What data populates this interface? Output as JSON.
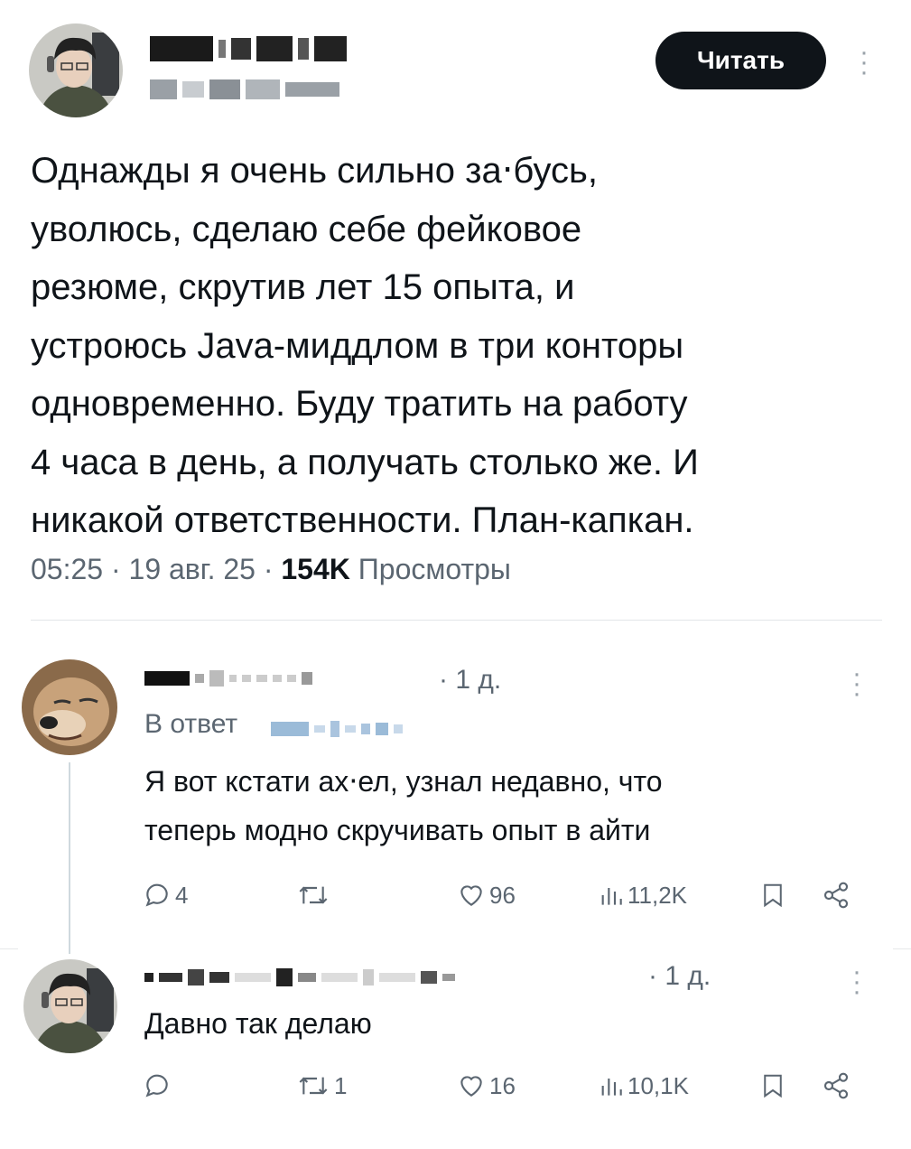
{
  "post": {
    "follow_label": "Читать",
    "text": "Однажды я очень сильно за‧бусь,\nуволюсь, сделаю себе фейковое\nрезюме, скрутив лет 15 опыта, и\nустроюсь Java-миддлом в три конторы\nодновременно. Буду тратить на работу\n4 часа в день, а получать столько же. И\nникакой ответственности. План-капкан.",
    "time": "05:25",
    "date": "19 авг. 25",
    "views_count": "154K",
    "views_label": "Просмотры"
  },
  "replies": [
    {
      "time_suffix": "· 1 д.",
      "reply_to_label": "В ответ",
      "text": "Я вот кстати ах‧ел, узнал недавно, что\nтеперь модно скручивать опыт в айти",
      "comments": "4",
      "reposts": "",
      "likes": "96",
      "views": "11,2K"
    },
    {
      "time_suffix": "· 1 д.",
      "text": "Давно так делаю",
      "comments": "",
      "reposts": "1",
      "likes": "16",
      "views": "10,1K"
    }
  ],
  "icons": [
    "avatar-icon",
    "more-icon",
    "comment-icon",
    "repost-icon",
    "like-icon",
    "views-icon",
    "bookmark-icon",
    "share-icon"
  ],
  "colors": {
    "text": "#0f1419",
    "secondary": "#5b6671",
    "button": "#0f1419",
    "divider": "#e3e6e9"
  }
}
